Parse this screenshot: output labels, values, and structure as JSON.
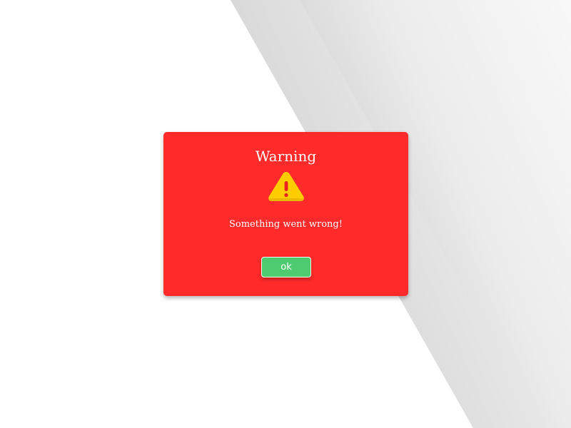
{
  "dialog": {
    "title": "Warning",
    "message": "Something went wrong!",
    "ok_label": "ok",
    "icon": "warning-triangle-icon"
  },
  "colors": {
    "page_background": "#ffffff",
    "dialog_background": "#ff2a2a",
    "button_background": "#4ecb71",
    "icon_fill": "#ffcc00",
    "icon_mark": "#e8231f",
    "text": "#ffffff"
  }
}
